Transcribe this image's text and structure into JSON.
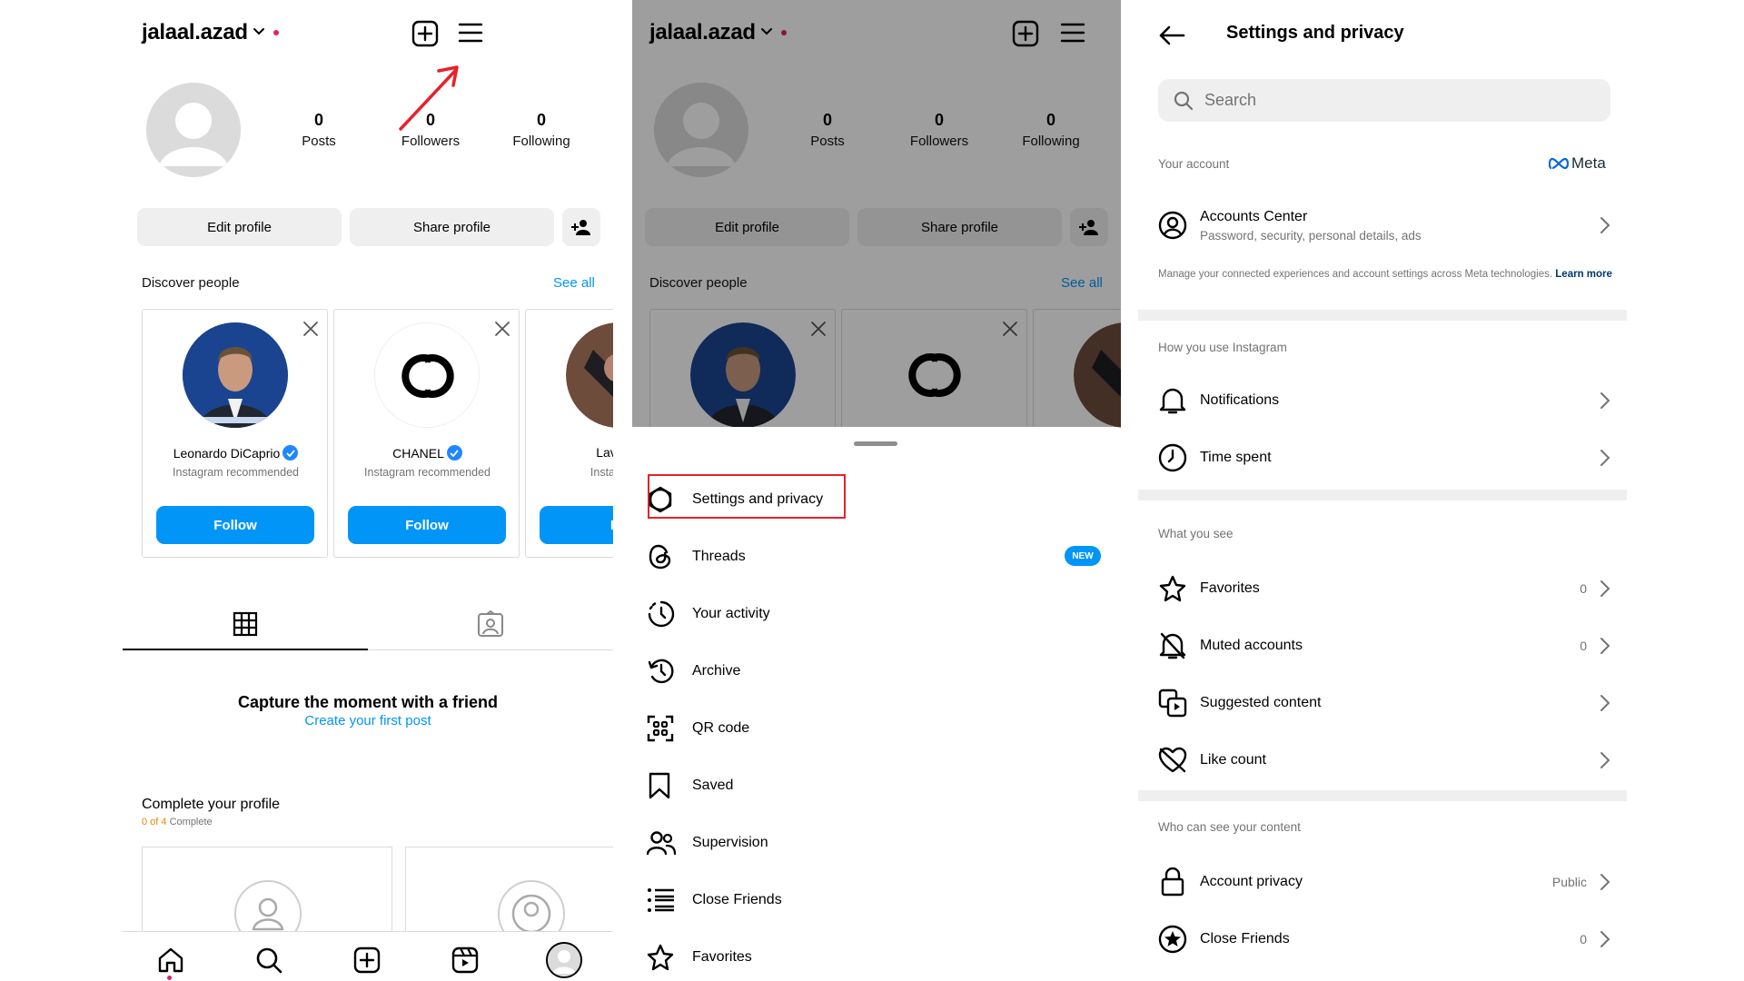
{
  "profile": {
    "username": "jalaal.azad",
    "stats": [
      {
        "num": "0",
        "label": "Posts"
      },
      {
        "num": "0",
        "label": "Followers"
      },
      {
        "num": "0",
        "label": "Following"
      }
    ],
    "edit_profile": "Edit profile",
    "share_profile": "Share profile",
    "discover_people": "Discover people",
    "see_all": "See all",
    "cards": [
      {
        "name": "Leonardo DiCaprio",
        "sub": "Instagram recommended",
        "follow": "Follow"
      },
      {
        "name": "CHANEL",
        "sub": "Instagram recommended",
        "follow": "Follow"
      },
      {
        "name": "Laverne",
        "sub": "Instagram r",
        "follow": "Fo"
      }
    ],
    "empty_title": "Capture the moment with a friend",
    "empty_link": "Create your first post",
    "complete_title": "Complete your profile",
    "complete_count": "0 of 4",
    "complete_word": "Complete"
  },
  "menu": {
    "items": [
      {
        "label": "Settings and privacy",
        "icon": "settings-icon"
      },
      {
        "label": "Threads",
        "icon": "threads-icon",
        "badge": "NEW"
      },
      {
        "label": "Your activity",
        "icon": "activity-icon"
      },
      {
        "label": "Archive",
        "icon": "archive-icon"
      },
      {
        "label": "QR code",
        "icon": "qr-code-icon"
      },
      {
        "label": "Saved",
        "icon": "bookmark-icon"
      },
      {
        "label": "Supervision",
        "icon": "supervision-icon"
      },
      {
        "label": "Close Friends",
        "icon": "close-friends-icon"
      },
      {
        "label": "Favorites",
        "icon": "star-icon"
      }
    ]
  },
  "settings": {
    "title": "Settings and privacy",
    "search_placeholder": "Search",
    "your_account": "Your account",
    "meta": "Meta",
    "accounts_center": "Accounts Center",
    "accounts_center_sub": "Password, security, personal details, ads",
    "manage_note": "Manage your connected experiences and account settings across Meta technologies.",
    "learn_more": "Learn more",
    "how_you_use": "How you use Instagram",
    "notifications": "Notifications",
    "time_spent": "Time spent",
    "what_you_see": "What you see",
    "favorites": "Favorites",
    "favorites_val": "0",
    "muted": "Muted accounts",
    "muted_val": "0",
    "suggested": "Suggested content",
    "like_count": "Like count",
    "who_can_see": "Who can see your content",
    "account_privacy": "Account privacy",
    "account_privacy_val": "Public",
    "close_friends": "Close Friends",
    "close_friends_val": "0"
  },
  "colors": {
    "accent_blue": "#0095f6",
    "highlight_red": "#e8202a",
    "badge_blue": "#0095f6"
  }
}
